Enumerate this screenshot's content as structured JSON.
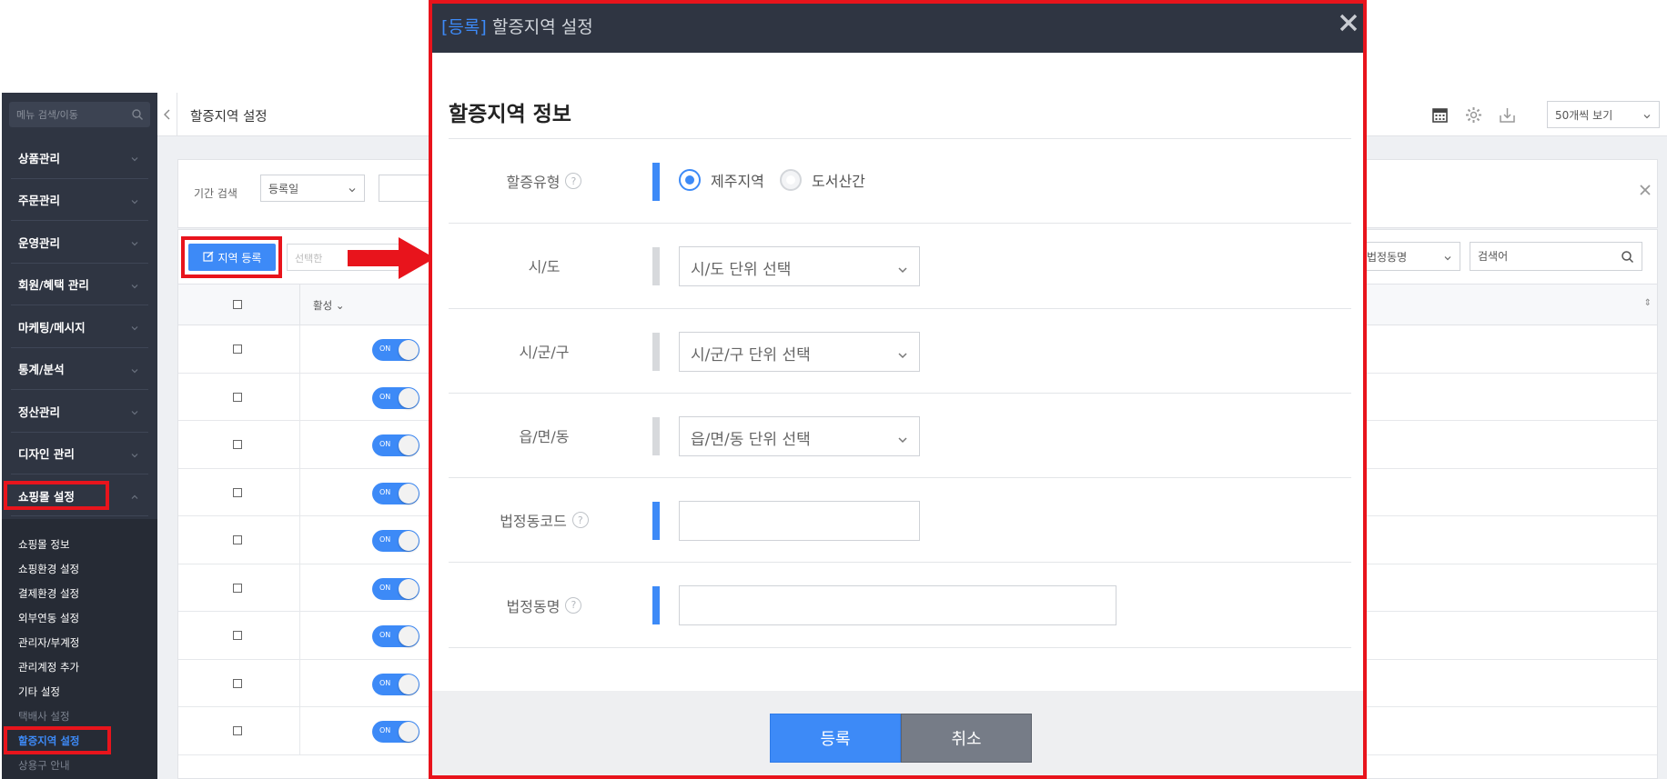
{
  "colors": {
    "sidebar_bg": "#2f3542",
    "accent": "#3d8af7",
    "highlight": "#e8141c",
    "modal_header": "#2f3542"
  },
  "sidebar": {
    "search_placeholder": "메뉴 검색/이동",
    "menu": [
      {
        "label": "상품관리",
        "icon": "chevron-down-icon"
      },
      {
        "label": "주문관리",
        "icon": "chevron-down-icon"
      },
      {
        "label": "운영관리",
        "icon": "chevron-down-icon"
      },
      {
        "label": "회원/혜택 관리",
        "icon": "chevron-down-icon"
      },
      {
        "label": "마케팅/메시지",
        "icon": "chevron-down-icon"
      },
      {
        "label": "통계/분석",
        "icon": "chevron-down-icon"
      },
      {
        "label": "정산관리",
        "icon": "chevron-down-icon"
      },
      {
        "label": "디자인 관리",
        "icon": "chevron-down-icon"
      },
      {
        "label": "쇼핑몰 설정",
        "icon": "chevron-up-icon"
      }
    ],
    "submenu": [
      {
        "label": "쇼핑몰 정보"
      },
      {
        "label": "쇼핑환경 설정"
      },
      {
        "label": "결제환경 설정"
      },
      {
        "label": "외부연동 설정"
      },
      {
        "label": "관리자/부계정"
      },
      {
        "label": "관리계정 추가"
      },
      {
        "label": "기타 설정"
      },
      {
        "label": "택배사 설정"
      },
      {
        "label": "할증지역 설정"
      },
      {
        "label": "상용구 안내"
      }
    ]
  },
  "header": {
    "title": "할증지역 설정",
    "per_page": "50개씩 보기"
  },
  "search": {
    "label": "기간 검색",
    "date_type": "등록일"
  },
  "list": {
    "register_button": "지역 등록",
    "selected_placeholder": "선택한",
    "filter_select": "법정동명",
    "keyword_placeholder": "검색어",
    "col_active": "활성",
    "toggle_label": "ON",
    "row_count": 9
  },
  "modal": {
    "title_tag": "[등록]",
    "title": "할증지역 설정",
    "section_title": "할증지역 정보",
    "fields": {
      "type_label": "할증유형",
      "type_options": [
        "제주지역",
        "도서산간"
      ],
      "type_selected": "제주지역",
      "sido_label": "시/도",
      "sido_placeholder": "시/도 단위 선택",
      "sigungu_label": "시/군/구",
      "sigungu_placeholder": "시/군/구 단위 선택",
      "eupmyeondong_label": "읍/면/동",
      "eupmyeondong_placeholder": "읍/면/동 단위 선택",
      "code_label": "법정동코드",
      "code_value": "",
      "name_label": "법정동명",
      "name_value": ""
    },
    "help_glyph": "?",
    "submit_button": "등록",
    "cancel_button": "취소"
  }
}
